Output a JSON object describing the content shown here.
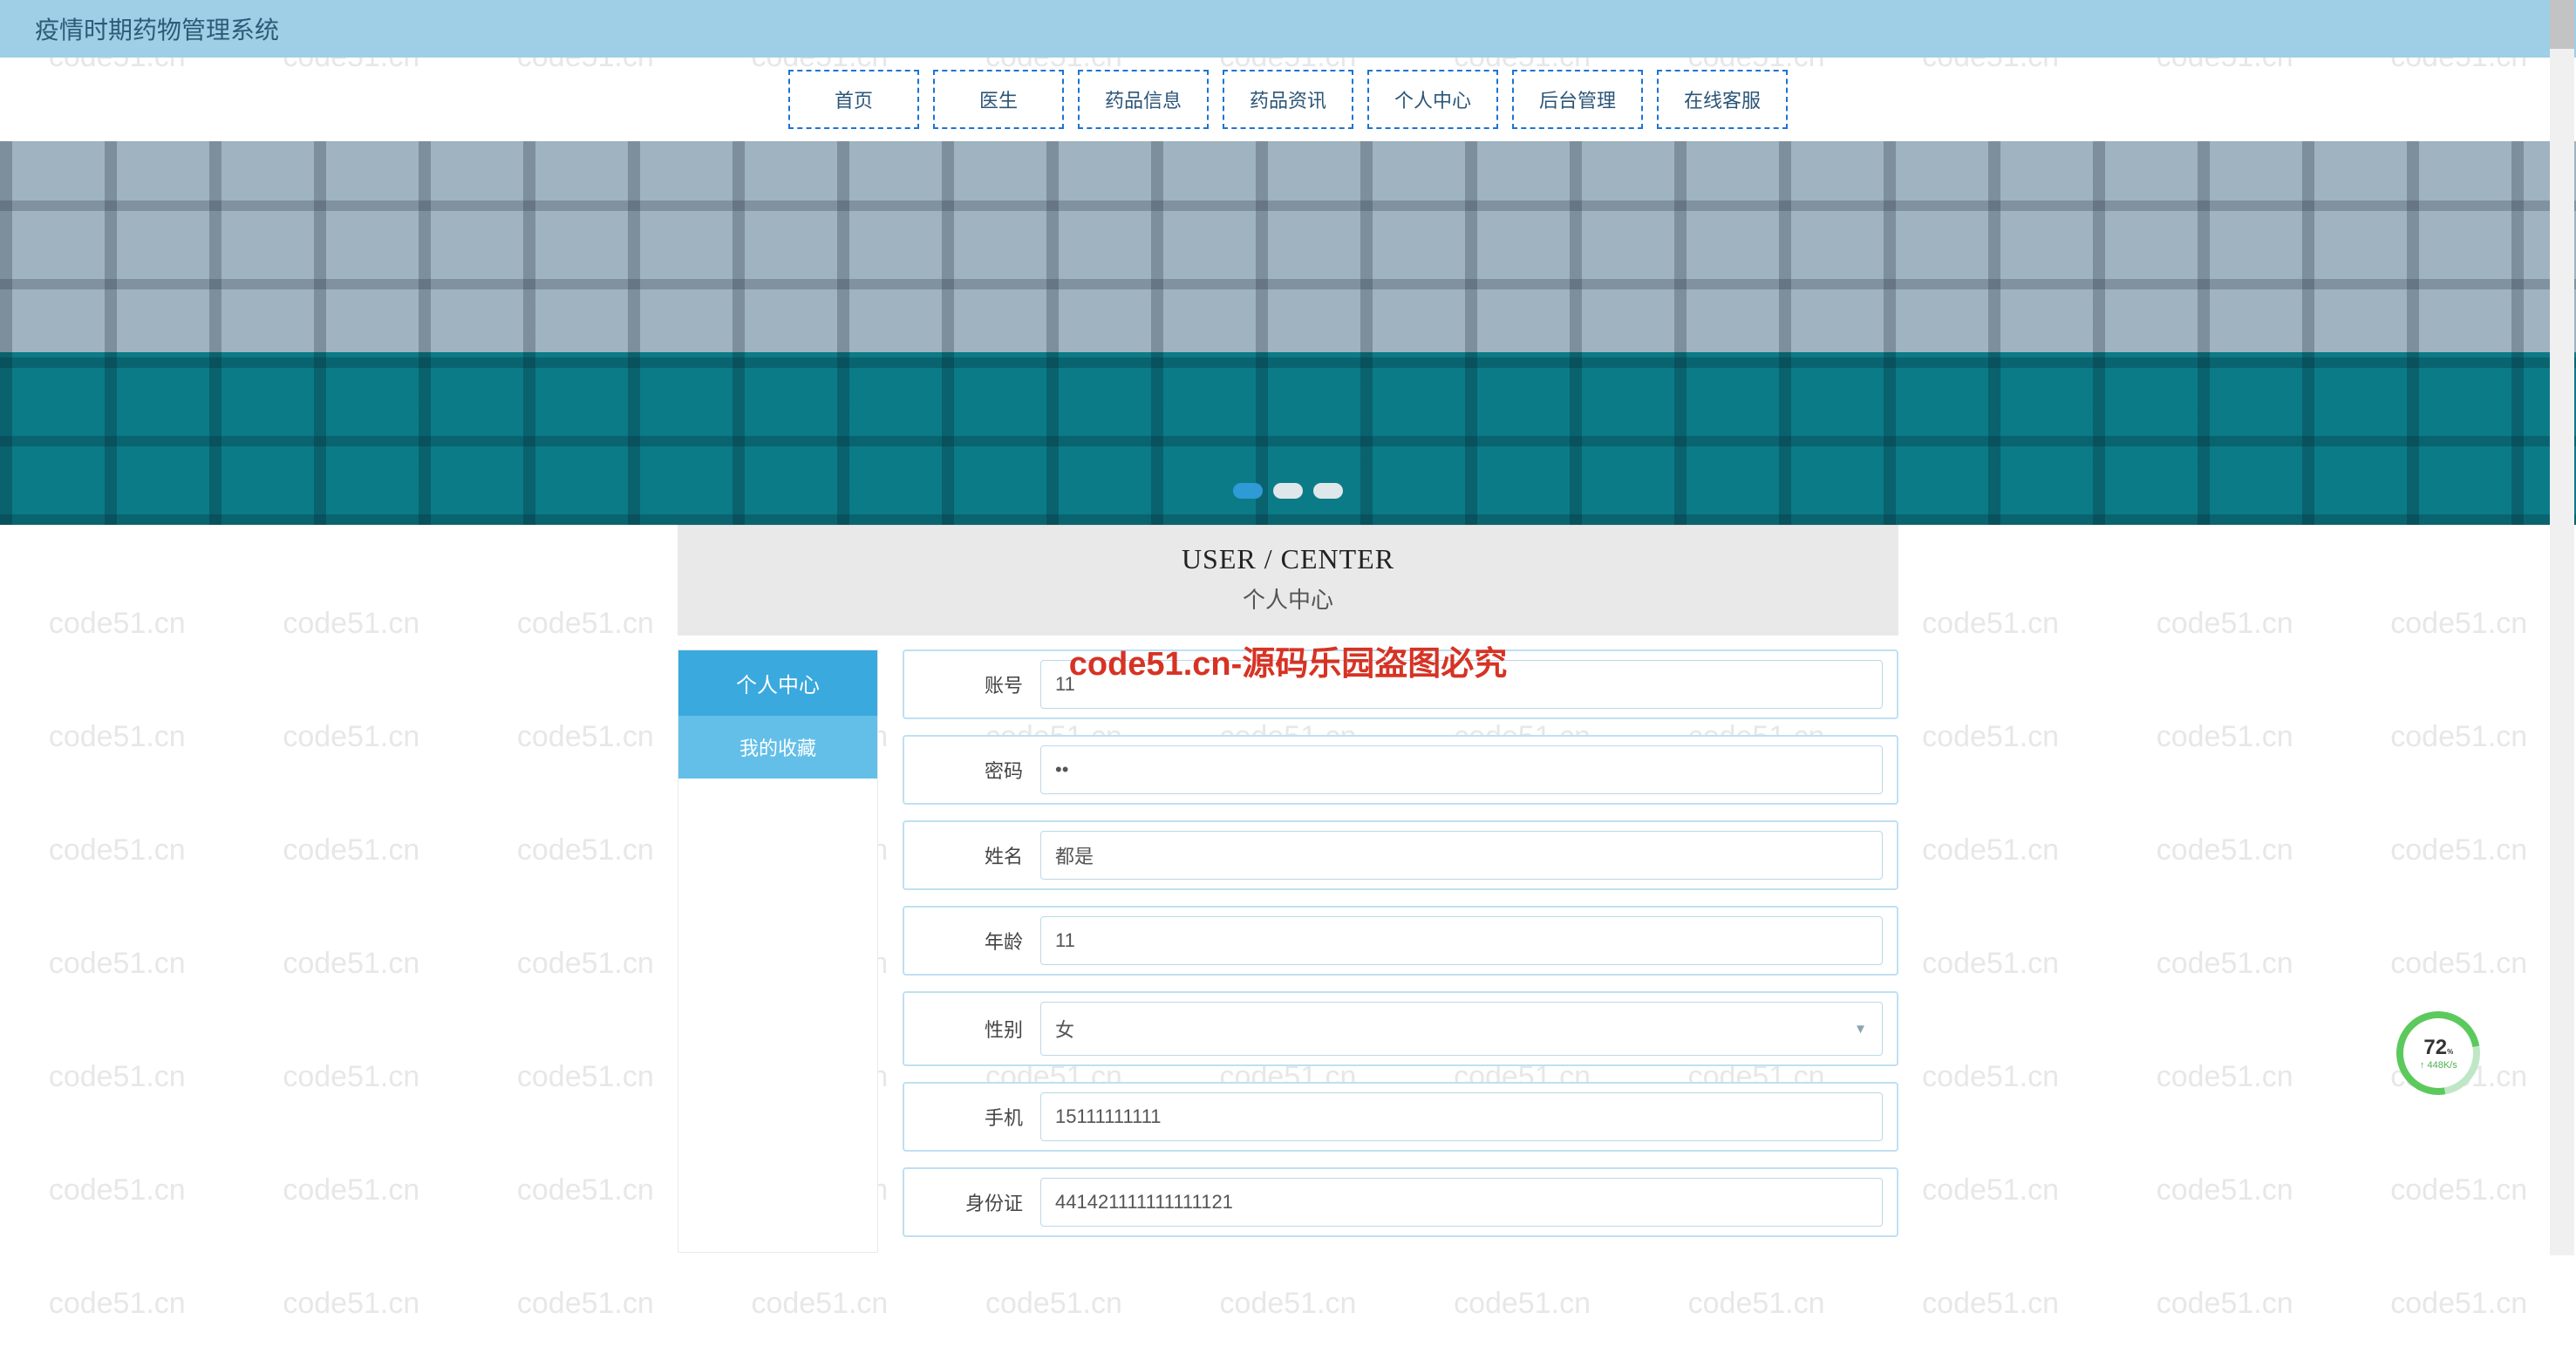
{
  "header": {
    "title": "疫情时期药物管理系统"
  },
  "nav": {
    "items": [
      "首页",
      "医生",
      "药品信息",
      "药品资讯",
      "个人中心",
      "后台管理",
      "在线客服"
    ]
  },
  "watermark_text": "code51.cn",
  "overlay_text": "code51.cn-源码乐园盗图必究",
  "section": {
    "en": "USER / CENTER",
    "zh": "个人中心"
  },
  "sidebar": {
    "items": [
      {
        "label": "个人中心",
        "active": true
      },
      {
        "label": "我的收藏",
        "active": false
      }
    ]
  },
  "form": {
    "fields": [
      {
        "label": "账号",
        "value": "11",
        "type": "text"
      },
      {
        "label": "密码",
        "value": "••",
        "type": "password"
      },
      {
        "label": "姓名",
        "value": "都是",
        "type": "text"
      },
      {
        "label": "年龄",
        "value": "11",
        "type": "text"
      },
      {
        "label": "性别",
        "value": "女",
        "type": "select"
      },
      {
        "label": "手机",
        "value": "15111111111",
        "type": "text"
      },
      {
        "label": "身份证",
        "value": "441421111111111121",
        "type": "text"
      }
    ]
  },
  "badge": {
    "pct": "72",
    "pct_sm": "%",
    "rate": "↑ 448K/s"
  },
  "carousel": {
    "active": 0,
    "count": 3
  }
}
